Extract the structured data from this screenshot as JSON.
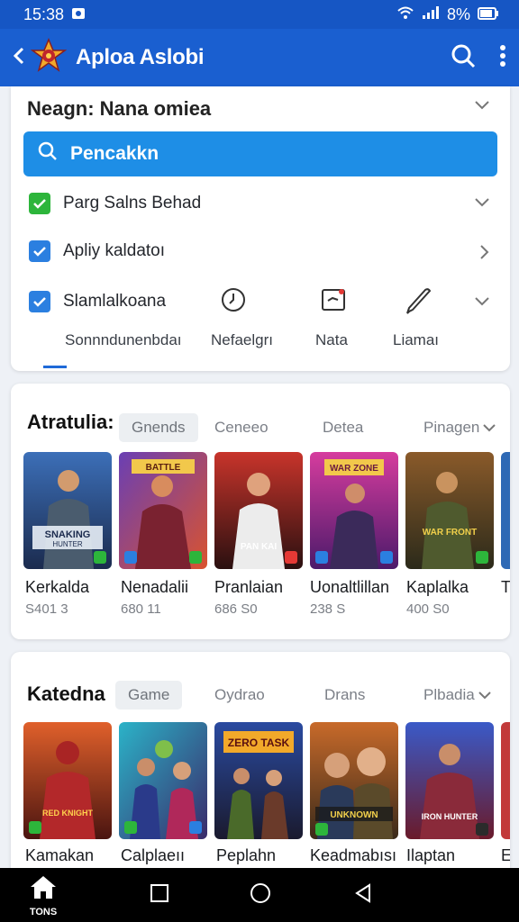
{
  "status_bar": {
    "time": "15:38"
  },
  "app_bar": {
    "title": "Aploa Aslobi"
  },
  "filter": {
    "header": "Neagn: Nana omiea",
    "search_label": "Pencakkn",
    "rows": [
      {
        "label": "Parg Salns Behad",
        "color": "#2db53b"
      },
      {
        "label": "Apliy kaldatoı",
        "color": "#2b7fe0"
      },
      {
        "label": "Slamlalkoana",
        "color": "#2b7fe0"
      }
    ],
    "quick_actions": [
      {
        "label": "Sonnndunenbdaı",
        "icon": ""
      },
      {
        "label": "Nefaelgrı",
        "icon": "clock-icon"
      },
      {
        "label": "Nata",
        "icon": "note-icon"
      },
      {
        "label": "Liamaı",
        "icon": "pen-icon"
      }
    ]
  },
  "section1": {
    "title": "Atratulia:",
    "tabs": [
      "Gnends",
      "Ceneeo",
      "Detea",
      "Pinagen"
    ],
    "items": [
      {
        "title": "Kerkalda",
        "sub": "S401 3",
        "art": "SNAKING HUNTER"
      },
      {
        "title": "Nenadalii",
        "sub": "680 11",
        "art": "BATTLE"
      },
      {
        "title": "Pranlaian",
        "sub": "686 S0",
        "art": "PAN KAI"
      },
      {
        "title": "Uonaltlillan",
        "sub": "238 S",
        "art": "WAR ZONE"
      },
      {
        "title": "Kaplalka",
        "sub": "400 S0",
        "art": "WAR FRONT"
      },
      {
        "title": "Tı",
        "sub": "",
        "art": ""
      }
    ]
  },
  "section2": {
    "title": "Katedna",
    "tabs": [
      "Game",
      "Oydrao",
      "Drans",
      "Plbadia"
    ],
    "items": [
      {
        "title": "Kamakan",
        "art": "RED KNIGHT"
      },
      {
        "title": "Calplaeıı",
        "art": ""
      },
      {
        "title": "Peplahn",
        "art": "ZERO TASK"
      },
      {
        "title": "Keadmabısı",
        "art": "UNKNOWN"
      },
      {
        "title": "Ilaptan",
        "art": "IRON HUNTER"
      },
      {
        "title": "E",
        "art": ""
      }
    ]
  },
  "nav": {
    "home_label": "TONS"
  },
  "colors": {
    "accent": "#1a5fd0",
    "status": "#1656c4",
    "search": "#1e8ee6"
  }
}
